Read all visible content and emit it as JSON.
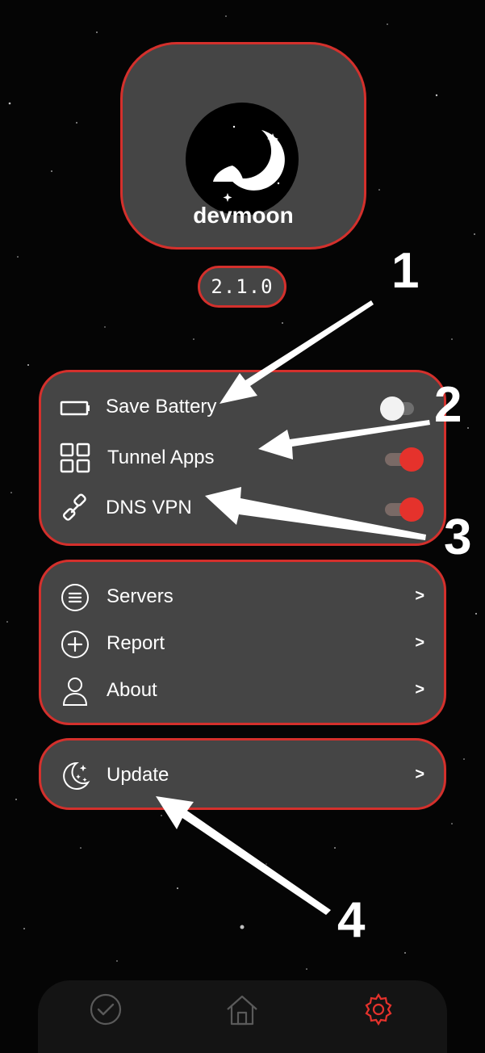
{
  "app": {
    "name": "devmoon",
    "version": "2.1.0"
  },
  "settings_toggles": [
    {
      "label": "Save Battery",
      "icon": "battery-icon",
      "enabled": false
    },
    {
      "label": "Tunnel Apps",
      "icon": "grid-icon",
      "enabled": true
    },
    {
      "label": "DNS VPN",
      "icon": "link-icon",
      "enabled": true
    }
  ],
  "menu_items": [
    {
      "label": "Servers",
      "icon": "list-icon",
      "chevron": ">"
    },
    {
      "label": "Report",
      "icon": "plus-circle-icon",
      "chevron": ">"
    },
    {
      "label": "About",
      "icon": "user-icon",
      "chevron": ">"
    }
  ],
  "update_item": {
    "label": "Update",
    "icon": "moon-stars-icon",
    "chevron": ">"
  },
  "annotations": [
    "1",
    "2",
    "3",
    "4"
  ],
  "bottom_nav": [
    {
      "icon": "check-circle-icon",
      "active": false
    },
    {
      "icon": "home-icon",
      "active": false
    },
    {
      "icon": "gear-icon",
      "active": true
    }
  ],
  "colors": {
    "background": "#050505",
    "card": "#454545",
    "accent_border": "#d4302c",
    "toggle_on": "#e5322c",
    "toggle_off": "#f2f2f2"
  }
}
